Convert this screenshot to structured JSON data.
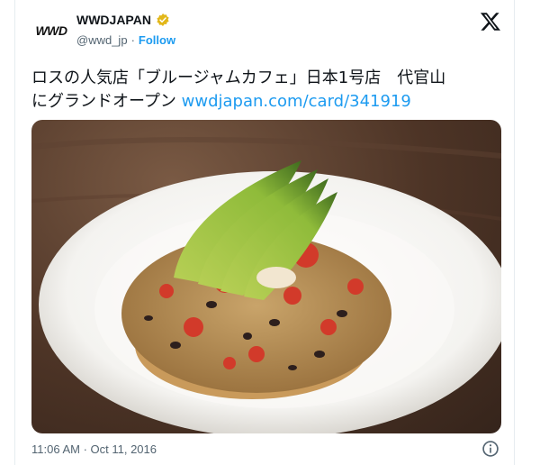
{
  "account": {
    "logo_text": "WWD",
    "display_name": "WWDJAPAN",
    "handle": "@wwd_jp",
    "separator": "·",
    "follow_label": "Follow"
  },
  "tweet": {
    "text_line1": "ロスの人気店「ブルージャムカフェ」日本1号店　代官山",
    "text_line2": "にグランドオープン ",
    "link": "wwdjapan.com/card/341919"
  },
  "media": {
    "description_icon": "food-photo"
  },
  "footer": {
    "timestamp": "11:06 AM · Oct 11, 2016"
  },
  "colors": {
    "link": "#1d9bf0",
    "verified_badge": "#e2b719",
    "secondary_text": "#536471"
  }
}
